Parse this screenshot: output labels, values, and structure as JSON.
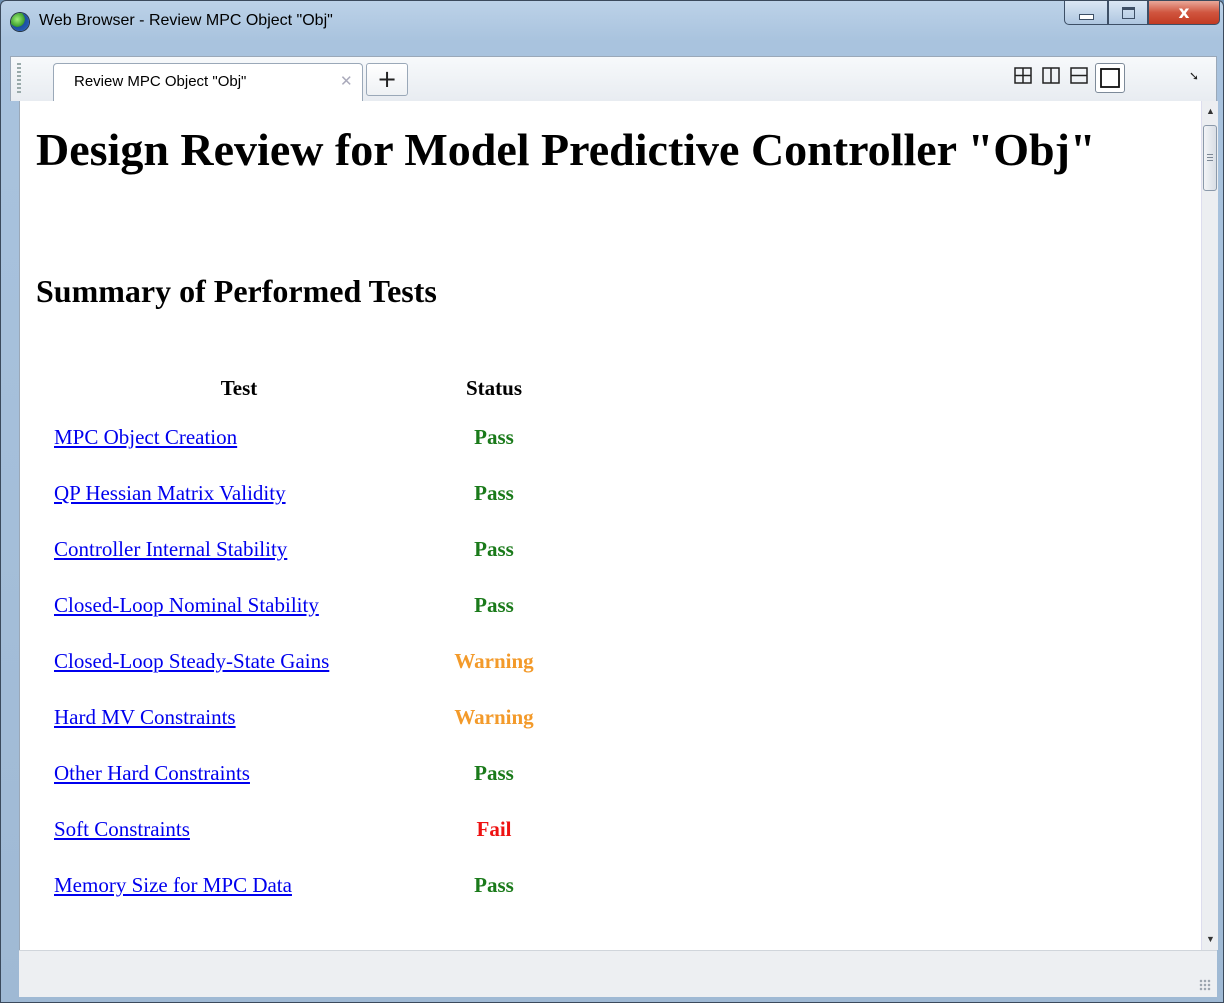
{
  "window": {
    "title": "Web Browser - Review MPC Object \"Obj\"",
    "controls": {
      "minimize_icon": "minimize-icon",
      "maximize_icon": "maximize-icon",
      "close_label": "x"
    }
  },
  "tabs": [
    {
      "label": "Review MPC Object \"Obj\"",
      "active": true
    }
  ],
  "toolbar": {
    "new_tab_label": "+",
    "layout_buttons": [
      "grid-2x2-icon",
      "split-vertical-icon",
      "split-horizontal-icon",
      "single-pane-icon"
    ],
    "active_layout": "single-pane-icon",
    "dock_icon": "undock-arrow-icon"
  },
  "page": {
    "title": "Design Review for Model Predictive Controller \"Obj\"",
    "summary_heading": "Summary of Performed Tests",
    "table": {
      "headers": {
        "test": "Test",
        "status": "Status"
      },
      "rows": [
        {
          "test": "MPC Object Creation",
          "status": "Pass"
        },
        {
          "test": "QP Hessian Matrix Validity",
          "status": "Pass"
        },
        {
          "test": "Controller Internal Stability",
          "status": "Pass"
        },
        {
          "test": "Closed-Loop Nominal Stability",
          "status": "Pass"
        },
        {
          "test": "Closed-Loop Steady-State Gains",
          "status": "Warning"
        },
        {
          "test": "Hard MV Constraints",
          "status": "Warning"
        },
        {
          "test": "Other Hard Constraints",
          "status": "Pass"
        },
        {
          "test": "Soft Constraints",
          "status": "Fail"
        },
        {
          "test": "Memory Size for MPC Data",
          "status": "Pass"
        }
      ]
    }
  },
  "colors": {
    "pass": "#1a7a1a",
    "warning": "#f39a2a",
    "fail": "#ee1111",
    "link": "#0000ee"
  }
}
